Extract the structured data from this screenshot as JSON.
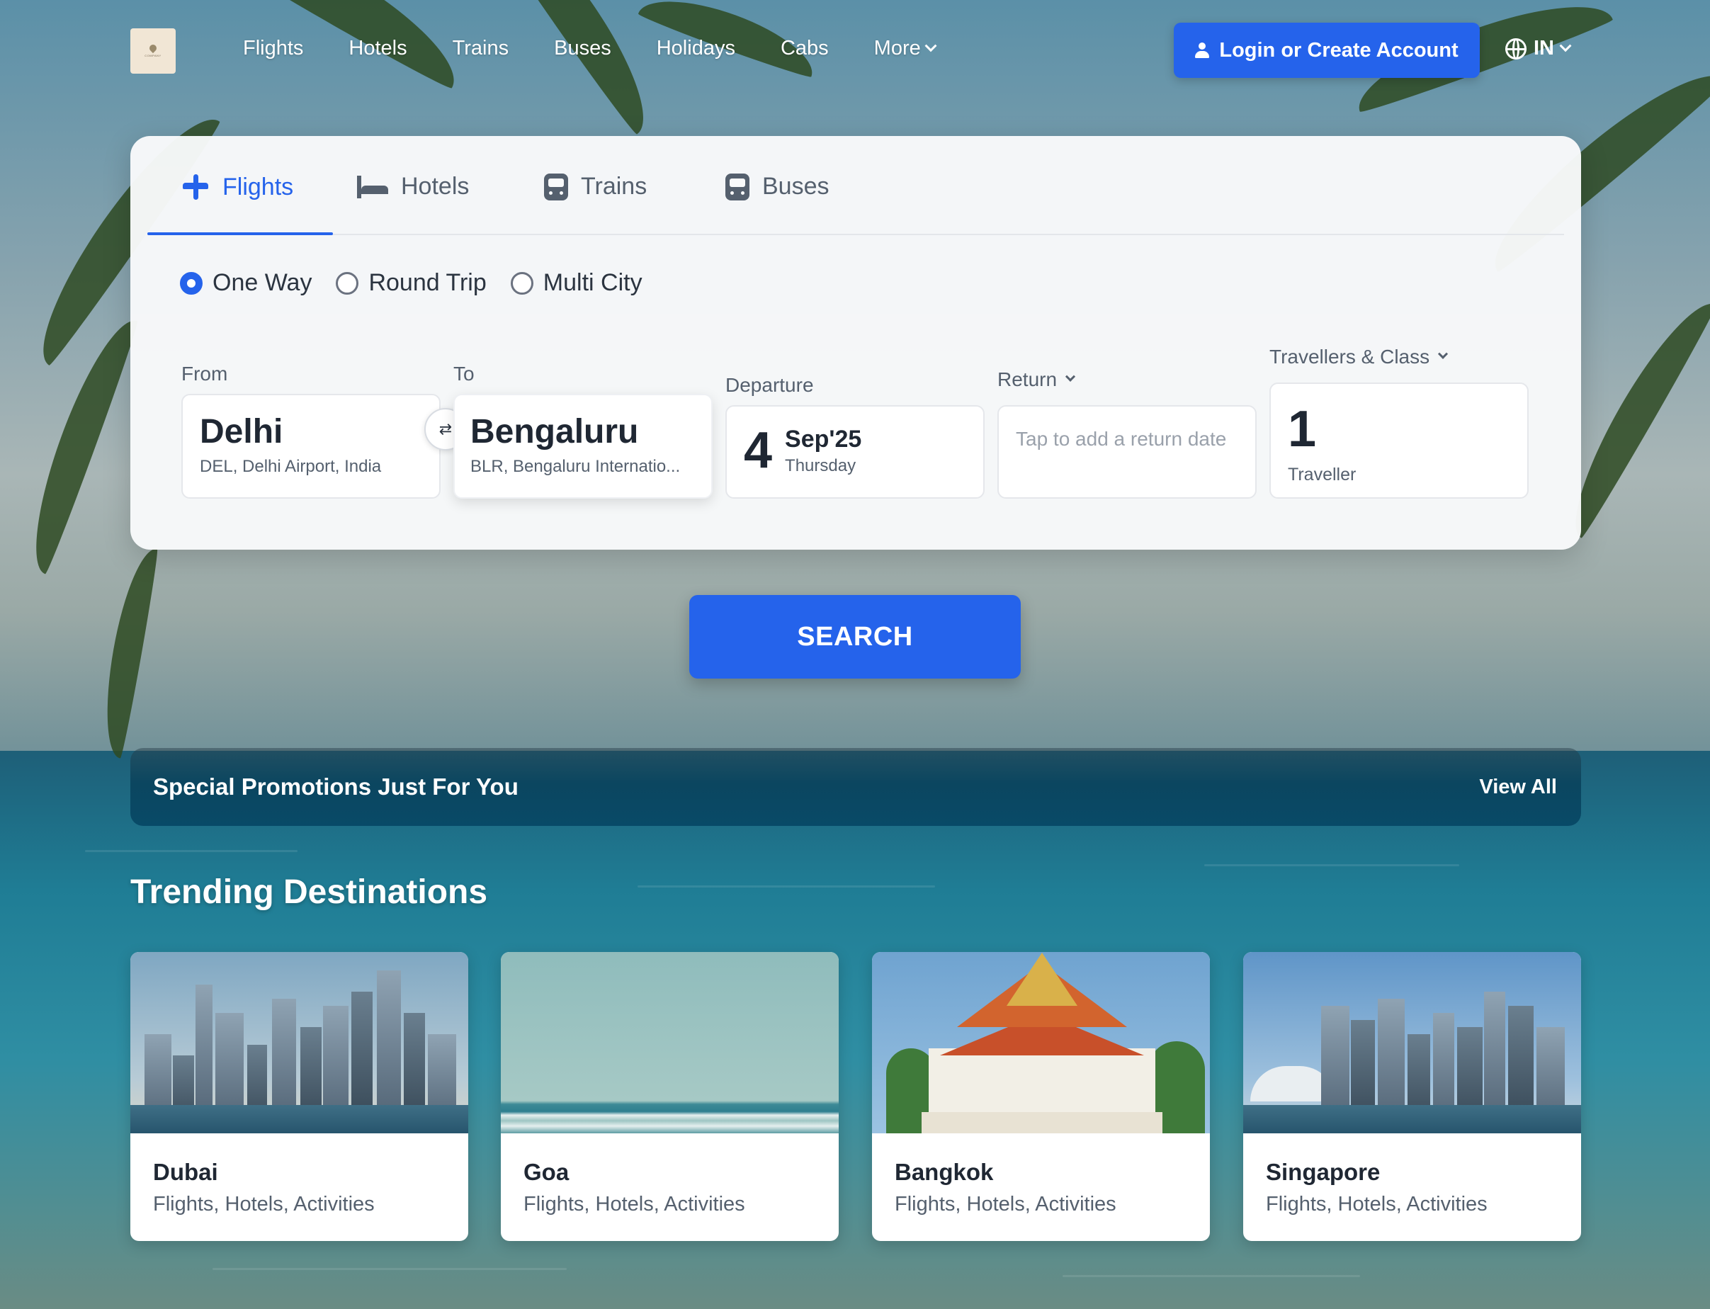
{
  "header": {
    "nav": [
      "Flights",
      "Hotels",
      "Trains",
      "Buses",
      "Holidays",
      "Cabs",
      "More"
    ],
    "login_label": "Login or Create Account",
    "region": "IN"
  },
  "search": {
    "tabs": [
      "Flights",
      "Hotels",
      "Trains",
      "Buses"
    ],
    "active_tab": "Flights",
    "trip_types": [
      "One Way",
      "Round Trip",
      "Multi City"
    ],
    "selected_trip_type": "One Way",
    "from": {
      "label": "From",
      "city": "Delhi",
      "detail": "DEL, Delhi Airport, India"
    },
    "to": {
      "label": "To",
      "city": "Bengaluru",
      "detail": "BLR, Bengaluru Internatio..."
    },
    "departure": {
      "label": "Departure",
      "day": "4",
      "month_year": "Sep'25",
      "weekday": "Thursday"
    },
    "return": {
      "label": "Return",
      "placeholder": "Tap to add a return date"
    },
    "travellers": {
      "label": "Travellers & Class",
      "count": "1",
      "unit": "Traveller"
    },
    "search_label": "SEARCH"
  },
  "promotions": {
    "title": "Special Promotions Just For You",
    "view_all": "View All"
  },
  "trending": {
    "title": "Trending Destinations",
    "destinations": [
      {
        "name": "Dubai",
        "desc": "Flights, Hotels, Activities"
      },
      {
        "name": "Goa",
        "desc": "Flights, Hotels, Activities"
      },
      {
        "name": "Bangkok",
        "desc": "Flights, Hotels, Activities"
      },
      {
        "name": "Singapore",
        "desc": "Flights, Hotels, Activities"
      }
    ]
  },
  "colors": {
    "accent": "#2563eb",
    "text_dark": "#1f2733",
    "text_muted": "#55606e"
  }
}
